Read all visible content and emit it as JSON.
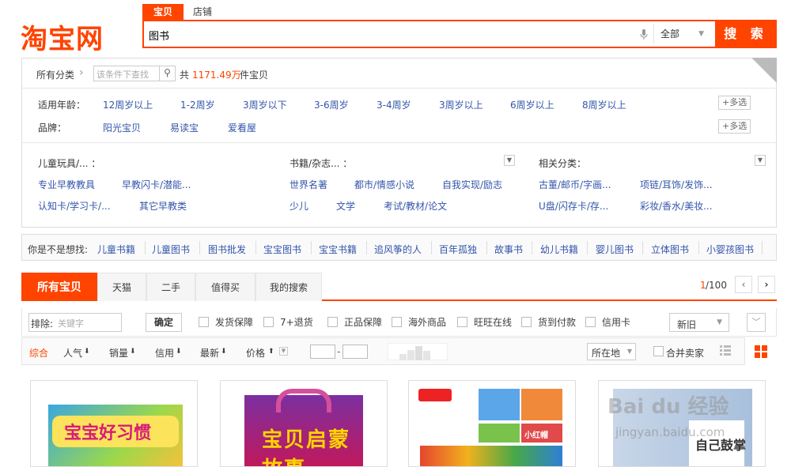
{
  "logo": {
    "text": "淘宝网"
  },
  "search_tabs": [
    "宝贝",
    "店铺"
  ],
  "search": {
    "value": "图书",
    "scope": "全部",
    "button": "搜 索"
  },
  "crumb": {
    "root": "所有分类",
    "arrow": "›",
    "filter_placeholder": "该条件下查找",
    "count_prefix": "共",
    "count": "1171.49万",
    "count_suffix": "件宝贝"
  },
  "age_row": {
    "label": "适用年龄：",
    "items": [
      "12周岁以上",
      "1-2周岁",
      "3周岁以下",
      "3-6周岁",
      "3-4周岁",
      "3周岁以上",
      "6周岁以上",
      "8周岁以上"
    ],
    "more": "+多选"
  },
  "brand_row": {
    "label": "品牌：",
    "items": [
      "阳光宝贝",
      "易读宝",
      "爱看屋"
    ],
    "more": "+多选"
  },
  "cat_cols": [
    {
      "title": "儿童玩具/...  ：",
      "items": [
        "专业早教教具",
        "早教闪卡/潜能...",
        "认知卡/学习卡/...",
        "其它早教类"
      ]
    },
    {
      "title": "书籍/杂志...  ：",
      "items": [
        "世界名著",
        "都市/情感小说",
        "自我实现/励志",
        "少儿",
        "文学",
        "考试/教材/论文"
      ]
    },
    {
      "title": "相关分类：",
      "items": [
        "古董/邮币/字画...",
        "项链/耳饰/发饰...",
        "U盘/闪存卡/存...",
        "彩妆/香水/美妆..."
      ]
    }
  ],
  "suggest": {
    "label": "你是不是想找:",
    "items": [
      "儿童书籍",
      "儿童图书",
      "图书批发",
      "宝宝图书",
      "宝宝书籍",
      "追风筝的人",
      "百年孤独",
      "故事书",
      "幼儿书籍",
      "婴儿图书",
      "立体图书",
      "小婴孩图书"
    ]
  },
  "main_tabs": [
    "所有宝贝",
    "天猫",
    "二手",
    "值得买",
    "我的搜索"
  ],
  "pager": {
    "current": "1",
    "total": "/100",
    "prev": "‹",
    "next": "›"
  },
  "options": {
    "exclude_label": "排除:",
    "exclude_placeholder": "关键字",
    "confirm": "确定",
    "checks": [
      "发货保障",
      "7+退货",
      "正品保障",
      "海外商品",
      "旺旺在线",
      "货到付款",
      "信用卡"
    ],
    "sort_select": "新旧"
  },
  "sortbar": {
    "items": [
      "综合",
      "人气",
      "销量",
      "信用",
      "最新",
      "价格"
    ],
    "location": "所在地",
    "merge": "合并卖家"
  },
  "cards": [
    {
      "title": "宝宝好习惯"
    },
    {
      "title": "宝贝启蒙故事"
    },
    {
      "title": "小红帽"
    },
    {
      "title": "自己鼓掌"
    }
  ],
  "watermark": {
    "text": "Bai du 经验",
    "url": "jingyan.baidu.com"
  },
  "colors": {
    "accent": "#ff4400",
    "link": "#3355aa"
  }
}
